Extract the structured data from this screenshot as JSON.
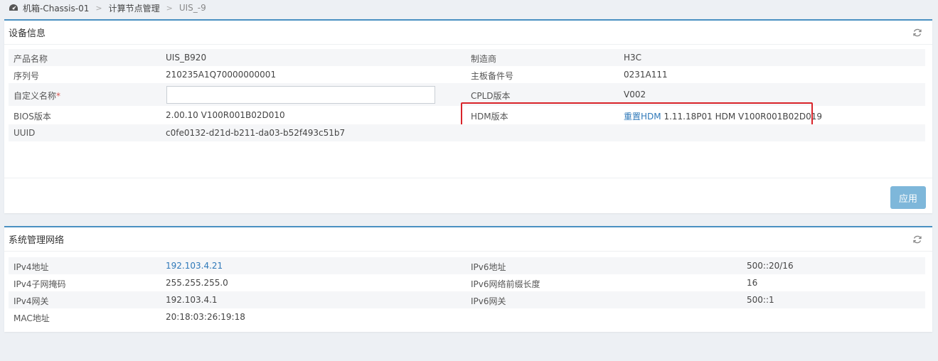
{
  "breadcrumb": {
    "items": [
      "机箱-Chassis-01",
      "计算节点管理"
    ],
    "current": "UIS_-9",
    "separator": ">"
  },
  "device_info": {
    "title": "设备信息",
    "rows": {
      "product_name": {
        "label": "产品名称",
        "value": "UIS_B920"
      },
      "manufacturer": {
        "label": "制造商",
        "value": "H3C"
      },
      "serial": {
        "label": "序列号",
        "value": "210235A1Q70000000001"
      },
      "board_part": {
        "label": "主板备件号",
        "value": "0231A111"
      },
      "custom_name": {
        "label": "自定义名称",
        "required_mark": "*",
        "value": ""
      },
      "cpld": {
        "label": "CPLD版本",
        "value": "V002"
      },
      "bios": {
        "label": "BIOS版本",
        "value": "2.00.10 V100R001B02D010"
      },
      "hdm": {
        "label": "HDM版本",
        "reset_link": "重置HDM",
        "value": "1.11.18P01 HDM V100R001B02D019"
      },
      "uuid": {
        "label": "UUID",
        "value": "c0fe0132-d21d-b211-da03-b52f493c51b7"
      }
    },
    "apply_label": "应用"
  },
  "network": {
    "title": "系统管理网络",
    "rows": {
      "ipv4": {
        "label": "IPv4地址",
        "value": "192.103.4.21"
      },
      "ipv6": {
        "label": "IPv6地址",
        "value": "500::20/16"
      },
      "ipv4_mask": {
        "label": "IPv4子网掩码",
        "value": "255.255.255.0"
      },
      "ipv6_prefix": {
        "label": "IPv6网络前缀长度",
        "value": "16"
      },
      "ipv4_gw": {
        "label": "IPv4网关",
        "value": "192.103.4.1"
      },
      "ipv6_gw": {
        "label": "IPv6网关",
        "value": "500::1"
      },
      "mac": {
        "label": "MAC地址",
        "value": "20:18:03:26:19:18"
      }
    }
  },
  "colors": {
    "accent": "#4a90c2",
    "link": "#2f79b9",
    "highlight": "#d9242a",
    "button": "#7eb7da"
  }
}
